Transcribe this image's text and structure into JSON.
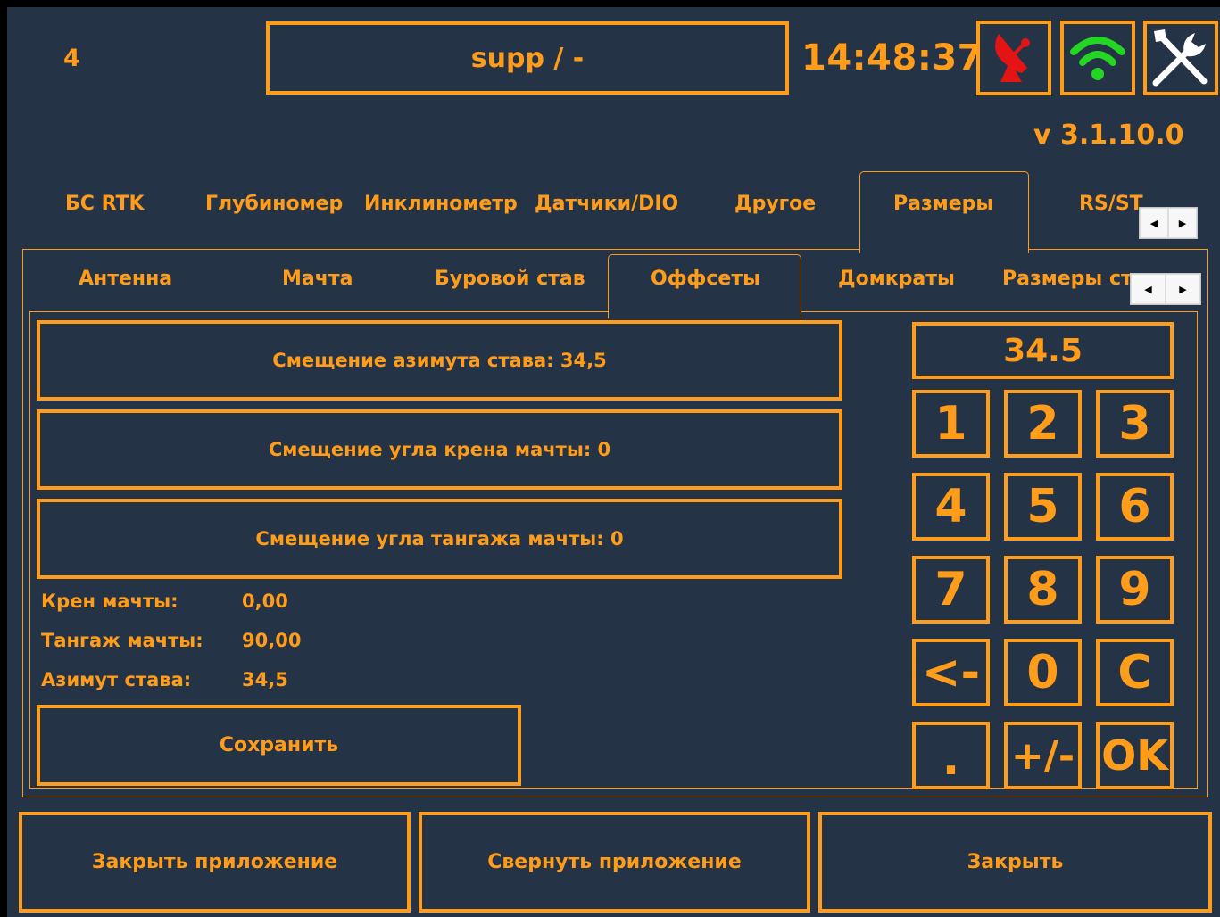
{
  "header": {
    "station_number": "4",
    "title": "supp / -",
    "time": "14:48:37",
    "version": "v 3.1.10.0",
    "icons": [
      "satellite-dish-icon",
      "wifi-icon",
      "tools-icon"
    ]
  },
  "main_tabs": [
    "БС RTK",
    "Глубиномер",
    "Инклинометр",
    "Датчики/DIO",
    "Другое",
    "Размеры",
    "RS/ST"
  ],
  "main_tab_active": "Размеры",
  "sub_tabs": [
    "Антенна",
    "Мачта",
    "Буровой став",
    "Оффсеты",
    "Домкраты",
    "Размеры ст"
  ],
  "sub_tab_active": "Оффсеты",
  "offsets": {
    "azimuth_button": "Смещение азимута става: 34,5",
    "roll_button": "Смещение угла крена мачты: 0",
    "pitch_button": "Смещение угла тангажа мачты: 0",
    "info": [
      {
        "label": "Крен мачты:",
        "value": "0,00"
      },
      {
        "label": "Тангаж мачты:",
        "value": "90,00"
      },
      {
        "label": "Азимут става:",
        "value": "34,5"
      }
    ],
    "save_button": "Сохранить"
  },
  "keypad": {
    "display": "34.5",
    "keys": [
      "1",
      "2",
      "3",
      "4",
      "5",
      "6",
      "7",
      "8",
      "9",
      "<-",
      "0",
      "C",
      ".",
      "+/-",
      "OK"
    ]
  },
  "footer": {
    "close_app": "Закрыть приложение",
    "minimize_app": "Свернуть приложение",
    "close": "Закрыть"
  },
  "colors": {
    "accent": "#ff9c1a",
    "background": "#253347",
    "status_red": "#ff1a1a",
    "status_green": "#22d622"
  }
}
